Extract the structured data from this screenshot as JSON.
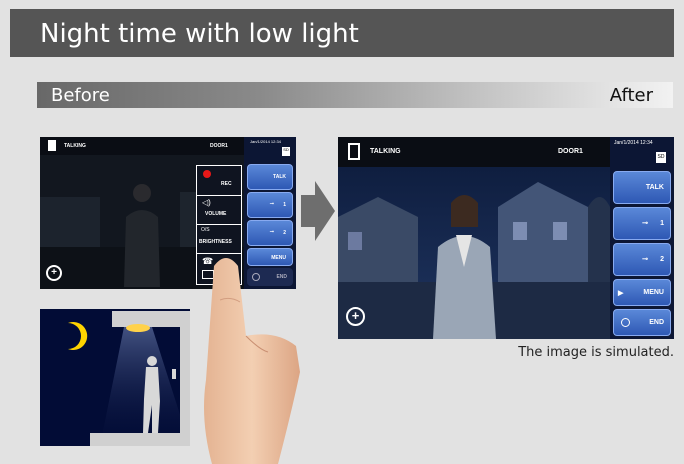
{
  "header": {
    "title": "Night time with low light"
  },
  "compare": {
    "before_label": "Before",
    "after_label": "After"
  },
  "caption": "The image is simulated.",
  "before_monitor": {
    "status": "TALKING",
    "door": "DOOR1",
    "datetime": "Jan/1/2014 12:34",
    "sd_label": "SD",
    "buttons": {
      "talk": "TALK",
      "key1": "1",
      "key2": "2",
      "menu": "MENU",
      "end": "END"
    },
    "popup": {
      "rec": "REC",
      "volume": "VOLUME",
      "brightness": "BRIGHTNESS",
      "o_c": "O/S"
    }
  },
  "after_monitor": {
    "status": "TALKING",
    "door": "DOOR1",
    "datetime": "Jan/1/2014 12:34",
    "sd_label": "SD",
    "buttons": {
      "talk": "TALK",
      "key1": "1",
      "key2": "2",
      "menu": "MENU",
      "end": "END"
    }
  },
  "colors": {
    "header_bg": "#555555",
    "page_bg": "#e2e2e2",
    "button_blue": "#3a6cc8",
    "night_sky": "#020c36"
  }
}
